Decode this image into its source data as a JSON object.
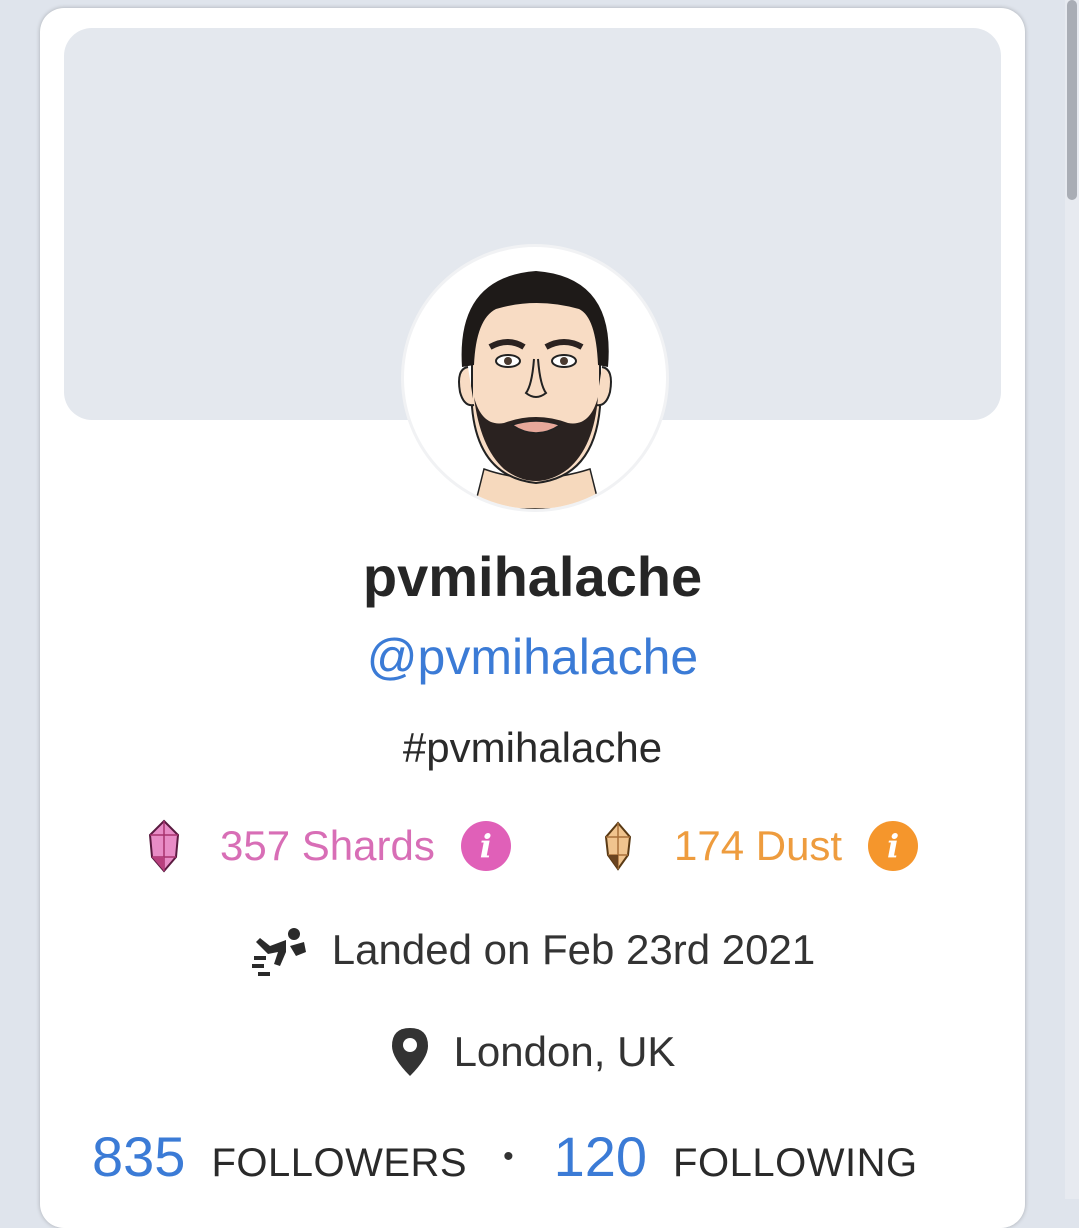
{
  "profile": {
    "display_name": "pvmihalache",
    "handle": "@pvmihalache",
    "tag": "#pvmihalache",
    "avatar_icon": "user-portrait-avatar"
  },
  "currencies": {
    "shards": {
      "label": "357 Shards",
      "icon": "pink-gem-icon",
      "color": "#d86eb6",
      "info_glyph": "i"
    },
    "dust": {
      "label": "174 Dust",
      "icon": "gold-gem-icon",
      "color": "#ee9c3e",
      "info_glyph": "i"
    }
  },
  "meta": {
    "landed": {
      "text": "Landed on Feb 23rd 2021",
      "icon": "skydiver-icon"
    },
    "location": {
      "text": "London, UK",
      "icon": "map-pin-icon"
    }
  },
  "stats": {
    "followers_count": "835",
    "followers_label": "FOLLOWERS",
    "separator": "•",
    "following_count": "120",
    "following_label": "FOLLOWING"
  },
  "colors": {
    "accent": "#3b7bd6",
    "shards": "#d86eb6",
    "dust": "#ee9c3e",
    "cover": "#e4e8ee"
  }
}
